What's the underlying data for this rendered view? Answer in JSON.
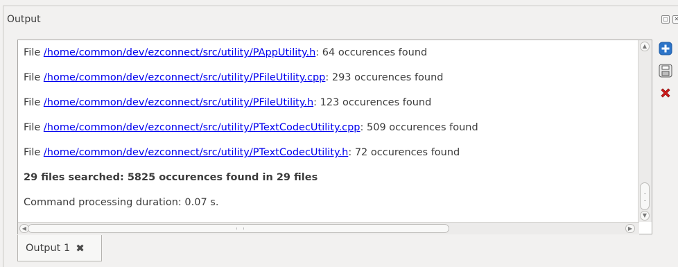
{
  "panel": {
    "title": "Output"
  },
  "output": {
    "lines": [
      {
        "prefix": "File ",
        "link": "/home/common/dev/ezconnect/src/utility/PAppUtility.h",
        "suffix": ": 64 occurences found"
      },
      {
        "prefix": "File ",
        "link": "/home/common/dev/ezconnect/src/utility/PFileUtility.cpp",
        "suffix": ": 293 occurences found"
      },
      {
        "prefix": "File ",
        "link": "/home/common/dev/ezconnect/src/utility/PFileUtility.h",
        "suffix": ": 123 occurences found"
      },
      {
        "prefix": "File ",
        "link": "/home/common/dev/ezconnect/src/utility/PTextCodecUtility.cpp",
        "suffix": ": 509 occurences found"
      },
      {
        "prefix": "File ",
        "link": "/home/common/dev/ezconnect/src/utility/PTextCodecUtility.h",
        "suffix": ": 72 occurences found"
      }
    ],
    "summary": "29 files searched: 5825 occurences found in 29 files",
    "duration": "Command processing duration: 0.07 s."
  },
  "tabs": [
    {
      "label": "Output 1"
    }
  ],
  "colors": {
    "link": "#0000ee",
    "add_button": "#2c74c8",
    "delete_button": "#d21a1a"
  },
  "icons": {
    "title_float": "float-icon",
    "title_close": "close-icon",
    "add": "add-icon",
    "save": "save-icon",
    "delete": "delete-icon",
    "tab_close": "tab-close-icon"
  }
}
